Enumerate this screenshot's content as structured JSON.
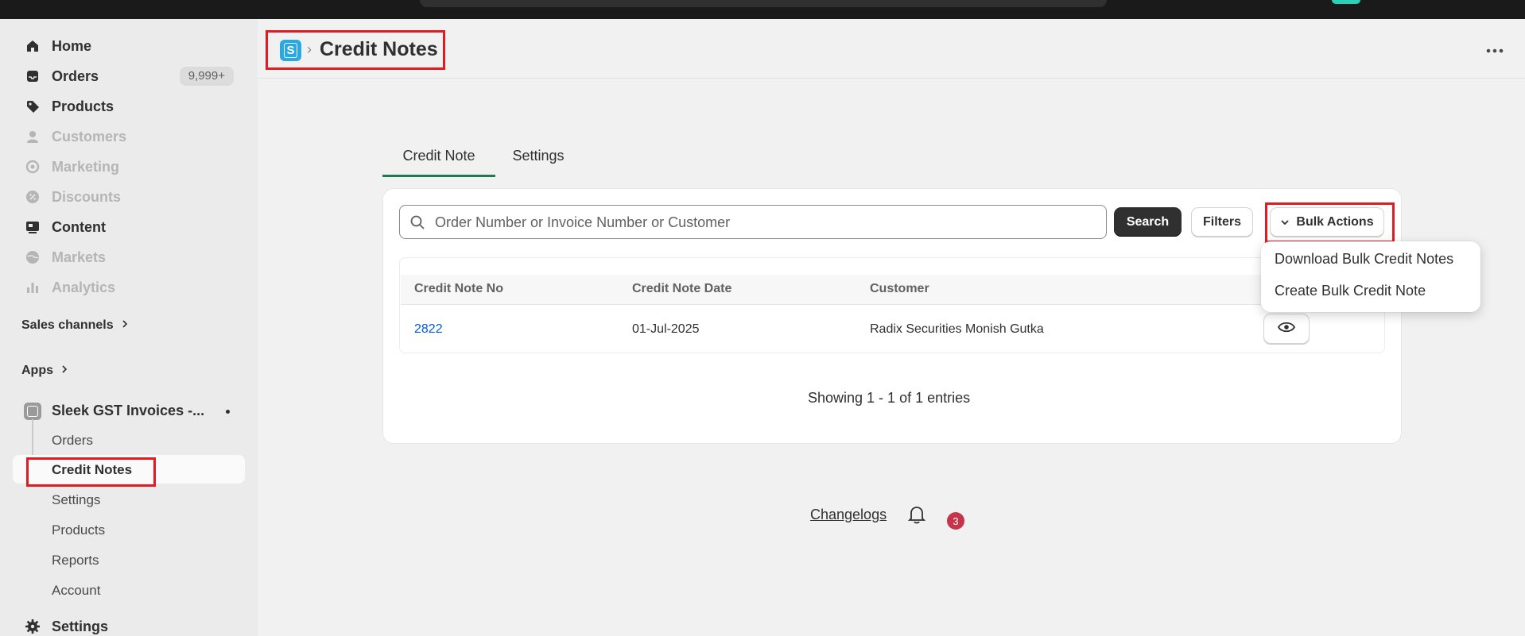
{
  "sidebar": {
    "items": [
      {
        "label": "Home",
        "icon": "home-icon",
        "enabled": true
      },
      {
        "label": "Orders",
        "icon": "inbox-icon",
        "count": "9,999+",
        "enabled": true
      },
      {
        "label": "Products",
        "icon": "tag-icon",
        "enabled": true
      },
      {
        "label": "Customers",
        "icon": "person-icon",
        "enabled": false
      },
      {
        "label": "Marketing",
        "icon": "target-icon",
        "enabled": false
      },
      {
        "label": "Discounts",
        "icon": "discount-icon",
        "enabled": false
      },
      {
        "label": "Content",
        "icon": "content-icon",
        "enabled": true
      },
      {
        "label": "Markets",
        "icon": "globe-icon",
        "enabled": false
      },
      {
        "label": "Analytics",
        "icon": "bar-chart-icon",
        "enabled": false
      }
    ],
    "sales_channels": "Sales channels",
    "apps": "Apps",
    "app_name": "Sleek GST Invoices -...",
    "app_subitems": [
      "Orders",
      "Credit Notes",
      "Settings",
      "Products",
      "Reports",
      "Account"
    ],
    "active_subitem": "Credit Notes",
    "settings": "Settings"
  },
  "header": {
    "title": "Credit Notes",
    "app_logo_letter": "S"
  },
  "tabs": [
    {
      "label": "Credit Note",
      "active": true
    },
    {
      "label": "Settings",
      "active": false
    }
  ],
  "search": {
    "placeholder": "Order Number or Invoice Number or Customer",
    "button_label": "Search"
  },
  "filters_label": "Filters",
  "bulk_actions_label": "Bulk Actions",
  "dropdown": {
    "items": [
      "Download Bulk Credit Notes",
      "Create Bulk Credit Note"
    ]
  },
  "table": {
    "columns": [
      "Credit Note No",
      "Credit Note Date",
      "Customer"
    ],
    "rows": [
      {
        "number": "2822",
        "date": "01-Jul-2025",
        "customer": "Radix Securities Monish Gutka"
      }
    ]
  },
  "showing_text": "Showing 1 - 1 of 1 entries",
  "footer": {
    "changelogs": "Changelogs",
    "notification_count": "3"
  },
  "colors": {
    "accent_tab": "#1d7a4f",
    "link": "#005bd3",
    "highlight": "#e11b22",
    "badge": "#c7344a"
  }
}
